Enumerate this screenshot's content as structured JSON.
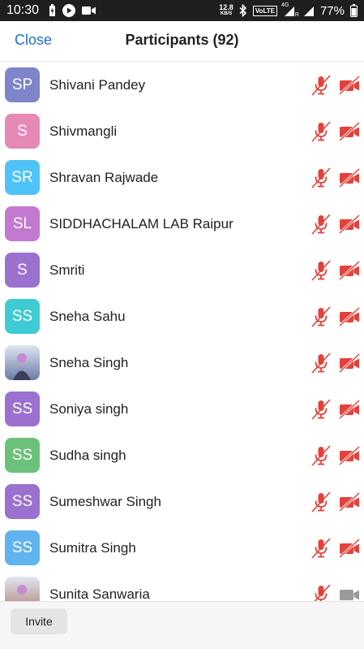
{
  "statusbar": {
    "time": "10:30",
    "net_speed": "12.8",
    "net_unit": "KB/S",
    "volte": "VoLTE",
    "signal_label": "4G",
    "roaming": "R",
    "battery": "77%",
    "icons": [
      "battery-charging-icon",
      "play-icon",
      "video-icon",
      "bluetooth-icon",
      "signal-icon",
      "battery-icon"
    ]
  },
  "header": {
    "close": "Close",
    "title": "Participants (92)"
  },
  "colors": {
    "accent": "#1e6fd1",
    "muted_red": "#e5413a",
    "camera_on_gray": "#9a9a9a"
  },
  "participants": [
    {
      "initials": "SP",
      "name": "Shivani Pandey",
      "color": "#7e86c9",
      "photo": false,
      "cam_off": true
    },
    {
      "initials": "S",
      "name": "Shivmangli",
      "color": "#e58ab7",
      "photo": false,
      "cam_off": true
    },
    {
      "initials": "SR",
      "name": "Shravan Rajwade",
      "color": "#4fc3f7",
      "photo": false,
      "cam_off": true
    },
    {
      "initials": "SL",
      "name": "SIDDHACHALAM LAB Raipur",
      "color": "#c27ad0",
      "photo": false,
      "cam_off": true
    },
    {
      "initials": "S",
      "name": "Smriti",
      "color": "#9b71cf",
      "photo": false,
      "cam_off": true
    },
    {
      "initials": "SS",
      "name": "Sneha Sahu",
      "color": "#3fcbd3",
      "photo": false,
      "cam_off": true
    },
    {
      "initials": "",
      "name": "Sneha Singh",
      "color": "#6b7aa6",
      "photo": true,
      "cam_off": true
    },
    {
      "initials": "SS",
      "name": "Soniya singh",
      "color": "#9b71cf",
      "photo": false,
      "cam_off": true
    },
    {
      "initials": "SS",
      "name": "Sudha singh",
      "color": "#6cc17a",
      "photo": false,
      "cam_off": true
    },
    {
      "initials": "SS",
      "name": "Sumeshwar Singh",
      "color": "#9b71cf",
      "photo": false,
      "cam_off": true
    },
    {
      "initials": "SS",
      "name": "Sumitra Singh",
      "color": "#5fb3ef",
      "photo": false,
      "cam_off": true
    },
    {
      "initials": "",
      "name": "Sunita Sanwaria",
      "color": "#b0837a",
      "photo": true,
      "cam_off": false
    }
  ],
  "footer": {
    "invite": "Invite"
  }
}
